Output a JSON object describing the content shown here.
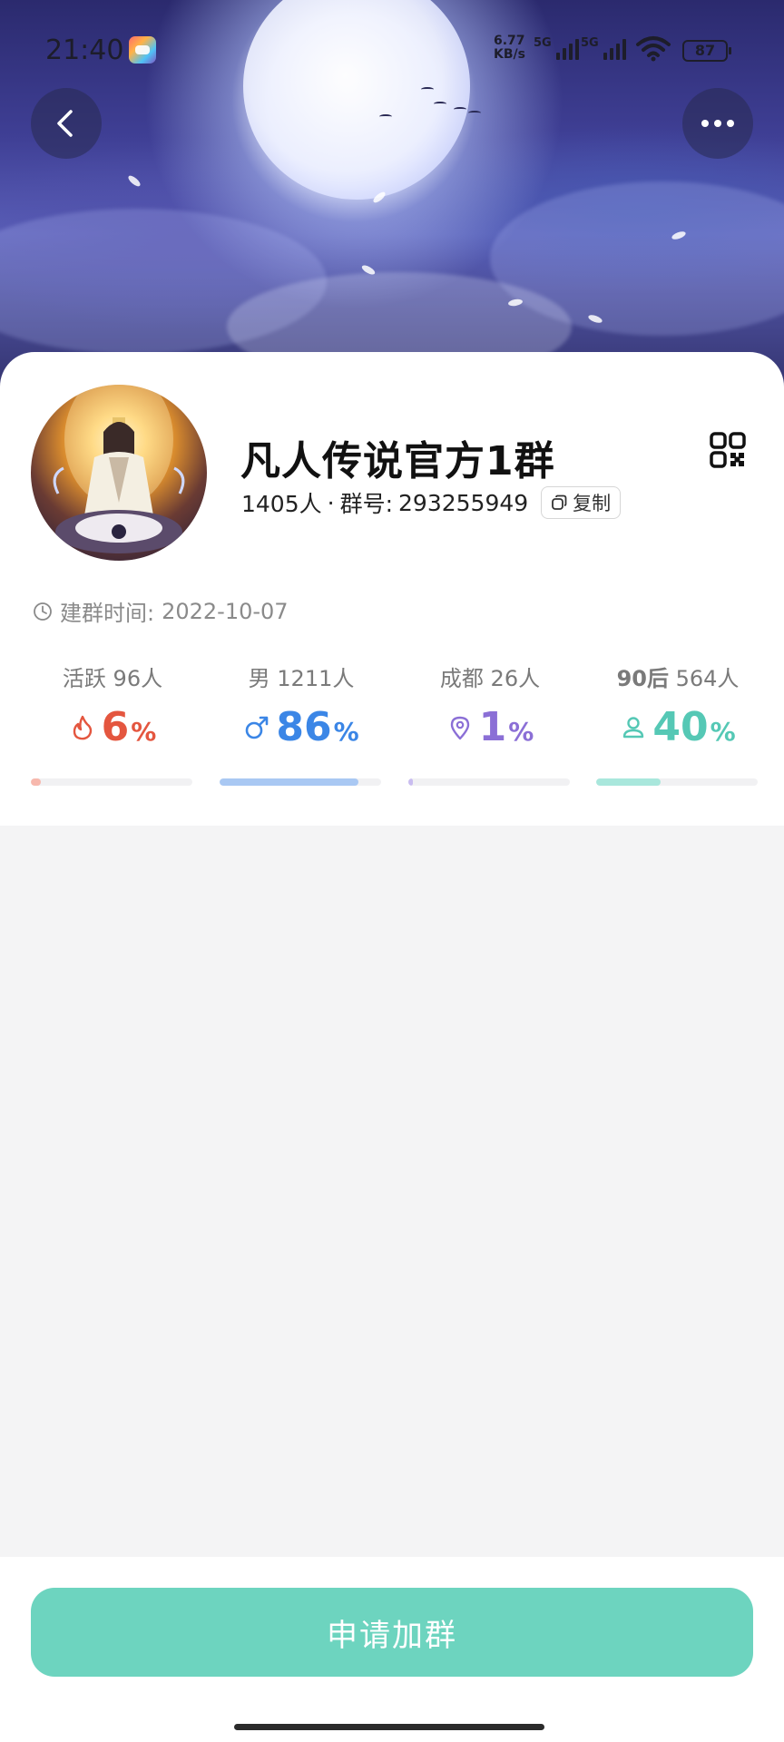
{
  "status_bar": {
    "time": "21:40",
    "net_speed_value": "6.77",
    "net_speed_unit": "KB/s",
    "signal1_label": "5G",
    "signal2_label": "5G",
    "battery": "87"
  },
  "nav": {
    "back_icon": "chevron-left-icon",
    "more_icon": "more-dots-icon"
  },
  "group": {
    "name": "凡人传说官方1群",
    "member_count": "1405人",
    "separator": "·",
    "id_label": "群号:",
    "id_value": "293255949",
    "copy_label": "复制",
    "created_label": "建群时间:",
    "created_date": "2022-10-07"
  },
  "stats": [
    {
      "label": "活跃",
      "count": "96",
      "unit": "人",
      "value": "6",
      "pct_sign": "%",
      "fraction": 0.06,
      "color": "#e4563f",
      "track_color": "#f7b8ad",
      "icon": "fire-icon"
    },
    {
      "label": "男",
      "count": "1211",
      "unit": "人",
      "value": "86",
      "pct_sign": "%",
      "fraction": 0.86,
      "color": "#3b86e6",
      "track_color": "#a9c8f3",
      "icon": "male-icon"
    },
    {
      "label": "成都",
      "count": "26",
      "unit": "人",
      "value": "1",
      "pct_sign": "%",
      "fraction": 0.01,
      "color": "#8b6fd6",
      "track_color": "#c9bdf0",
      "icon": "location-pin-icon"
    },
    {
      "label": "90后",
      "count": "564",
      "unit": "人",
      "value": "40",
      "pct_sign": "%",
      "fraction": 0.4,
      "color": "#55c8b5",
      "track_color": "#a9e7dc",
      "icon": "person-icon"
    }
  ],
  "footer": {
    "join_label": "申请加群"
  },
  "colors": {
    "accent": "#6dd4bf"
  }
}
